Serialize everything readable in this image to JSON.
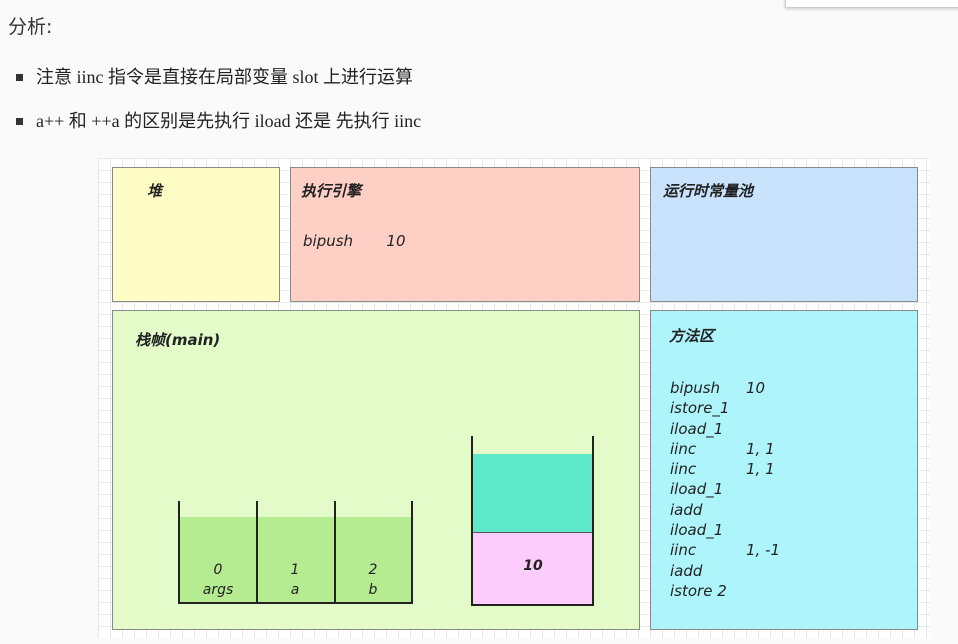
{
  "heading": "分析:",
  "bullets": [
    "注意 iinc 指令是直接在局部变量 slot 上进行运算",
    "a++ 和 ++a 的区别是先执行 iload 还是 先执行 iinc"
  ],
  "diagram": {
    "heap": {
      "title": "堆"
    },
    "engine": {
      "title": "执行引擎",
      "instruction": "bipush       10"
    },
    "pool": {
      "title": "运行时常量池"
    },
    "frame": {
      "title": "栈帧(main)",
      "local_slots": [
        {
          "index": "0",
          "name": "args"
        },
        {
          "index": "1",
          "name": "a"
        },
        {
          "index": "2",
          "name": "b"
        }
      ],
      "operand_stack": [
        "10"
      ]
    },
    "method_area": {
      "title": "方法区",
      "code": [
        {
          "op": "bipush",
          "arg": "10"
        },
        {
          "op": "istore_1",
          "arg": ""
        },
        {
          "op": "iload_1",
          "arg": ""
        },
        {
          "op": "iinc",
          "arg": "1, 1"
        },
        {
          "op": "iinc",
          "arg": "1, 1"
        },
        {
          "op": "iload_1",
          "arg": ""
        },
        {
          "op": "iadd",
          "arg": ""
        },
        {
          "op": "iload_1",
          "arg": ""
        },
        {
          "op": "iinc",
          "arg": "1, -1"
        },
        {
          "op": "iadd",
          "arg": ""
        },
        {
          "op": "istore 2",
          "arg": ""
        }
      ]
    }
  }
}
